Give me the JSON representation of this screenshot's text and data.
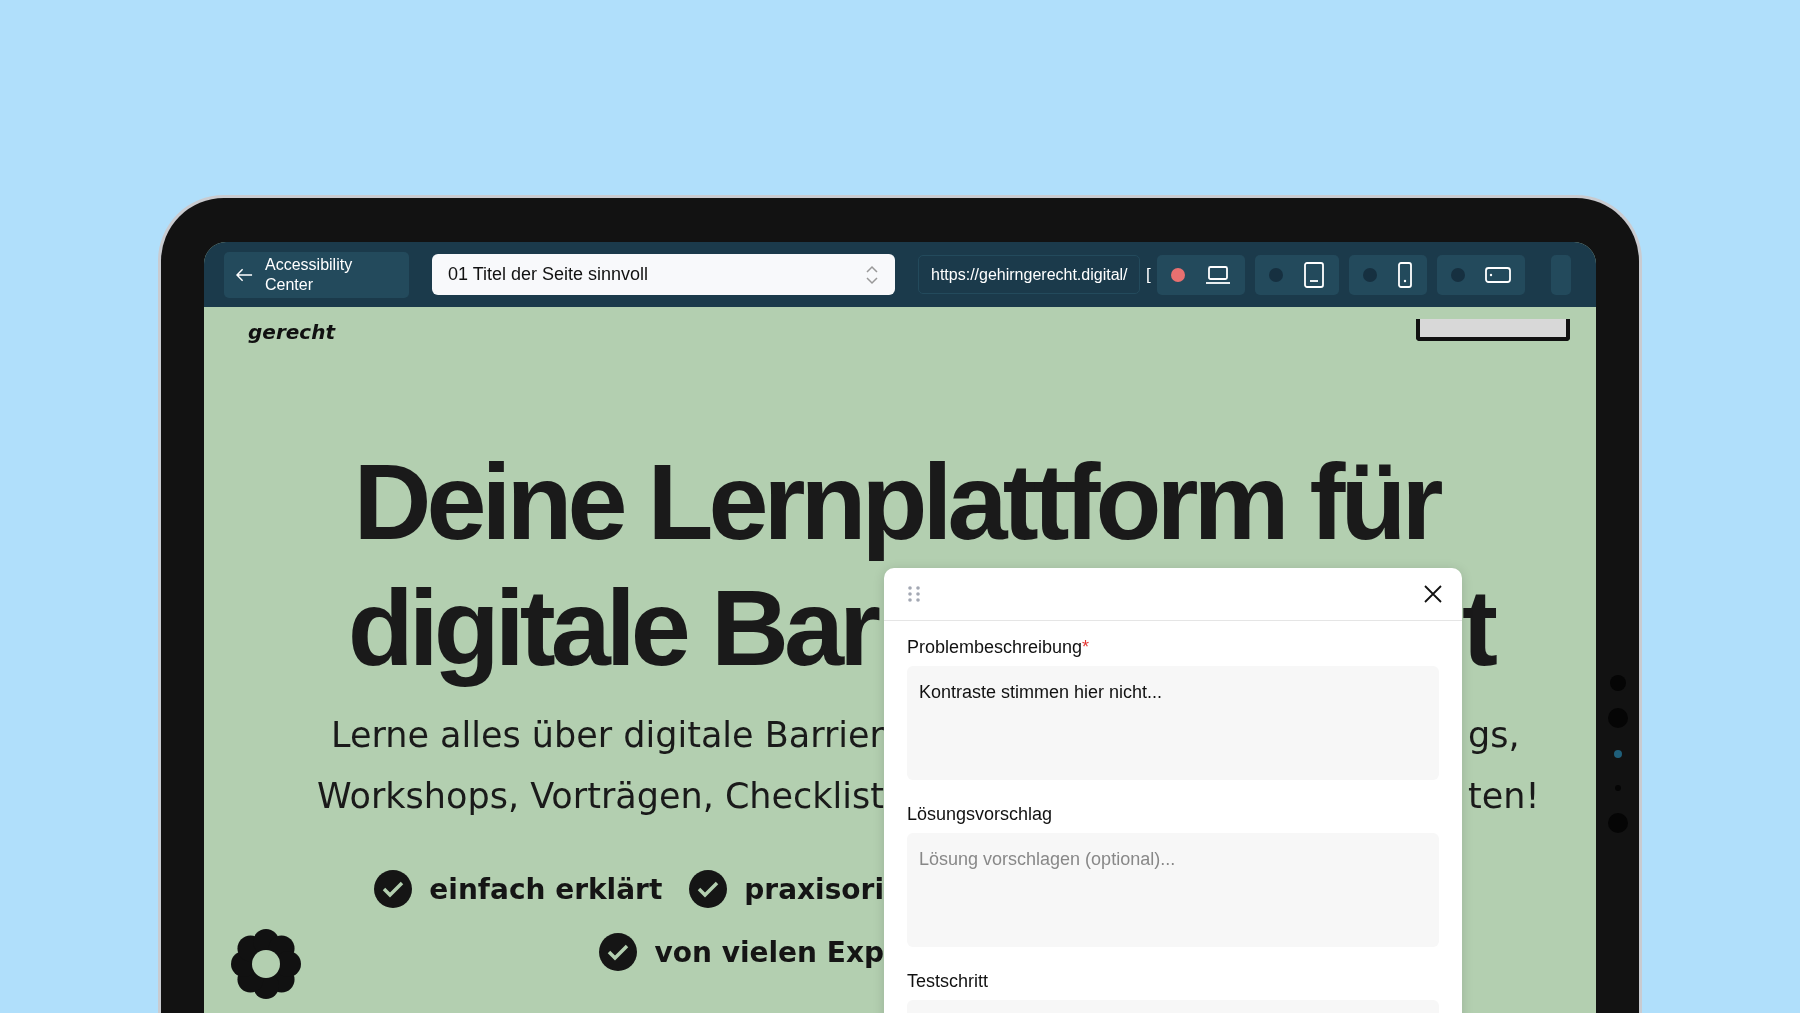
{
  "toolbar": {
    "back_label": "Accessibility Center",
    "page_select": {
      "value": "01 Titel der Seite sinnvoll"
    },
    "url": {
      "value": "https://gehirngerecht.digital/"
    },
    "url_tail": "[",
    "devices": [
      {
        "kind": "laptop",
        "selected": true
      },
      {
        "kind": "tablet",
        "selected": false
      },
      {
        "kind": "phone",
        "selected": false
      },
      {
        "kind": "landscape",
        "selected": false
      }
    ]
  },
  "site": {
    "logo_text": "gerecht",
    "heading_line_1": "Deine Lernplattform für",
    "heading_line_2": {
      "left": "digitale Bar",
      "right": "t"
    },
    "intro_lines": [
      {
        "left": "Lerne alles über digitale Barrier",
        "right": "gs,"
      },
      {
        "left": "Workshops, Vorträgen, Checklist",
        "right": "ten!"
      }
    ],
    "features": [
      [
        "einfach erklärt",
        "praxisori"
      ],
      [
        "von vielen Exp"
      ]
    ]
  },
  "dialog": {
    "fields": [
      {
        "label": "Problembeschreibung",
        "required_mark": "*",
        "value": "Kontraste stimmen hier nicht..."
      },
      {
        "label": "Lösungsvorschlag",
        "placeholder": "Lösung vorschlagen (optional)..."
      },
      {
        "label": "Testschritt"
      }
    ]
  }
}
